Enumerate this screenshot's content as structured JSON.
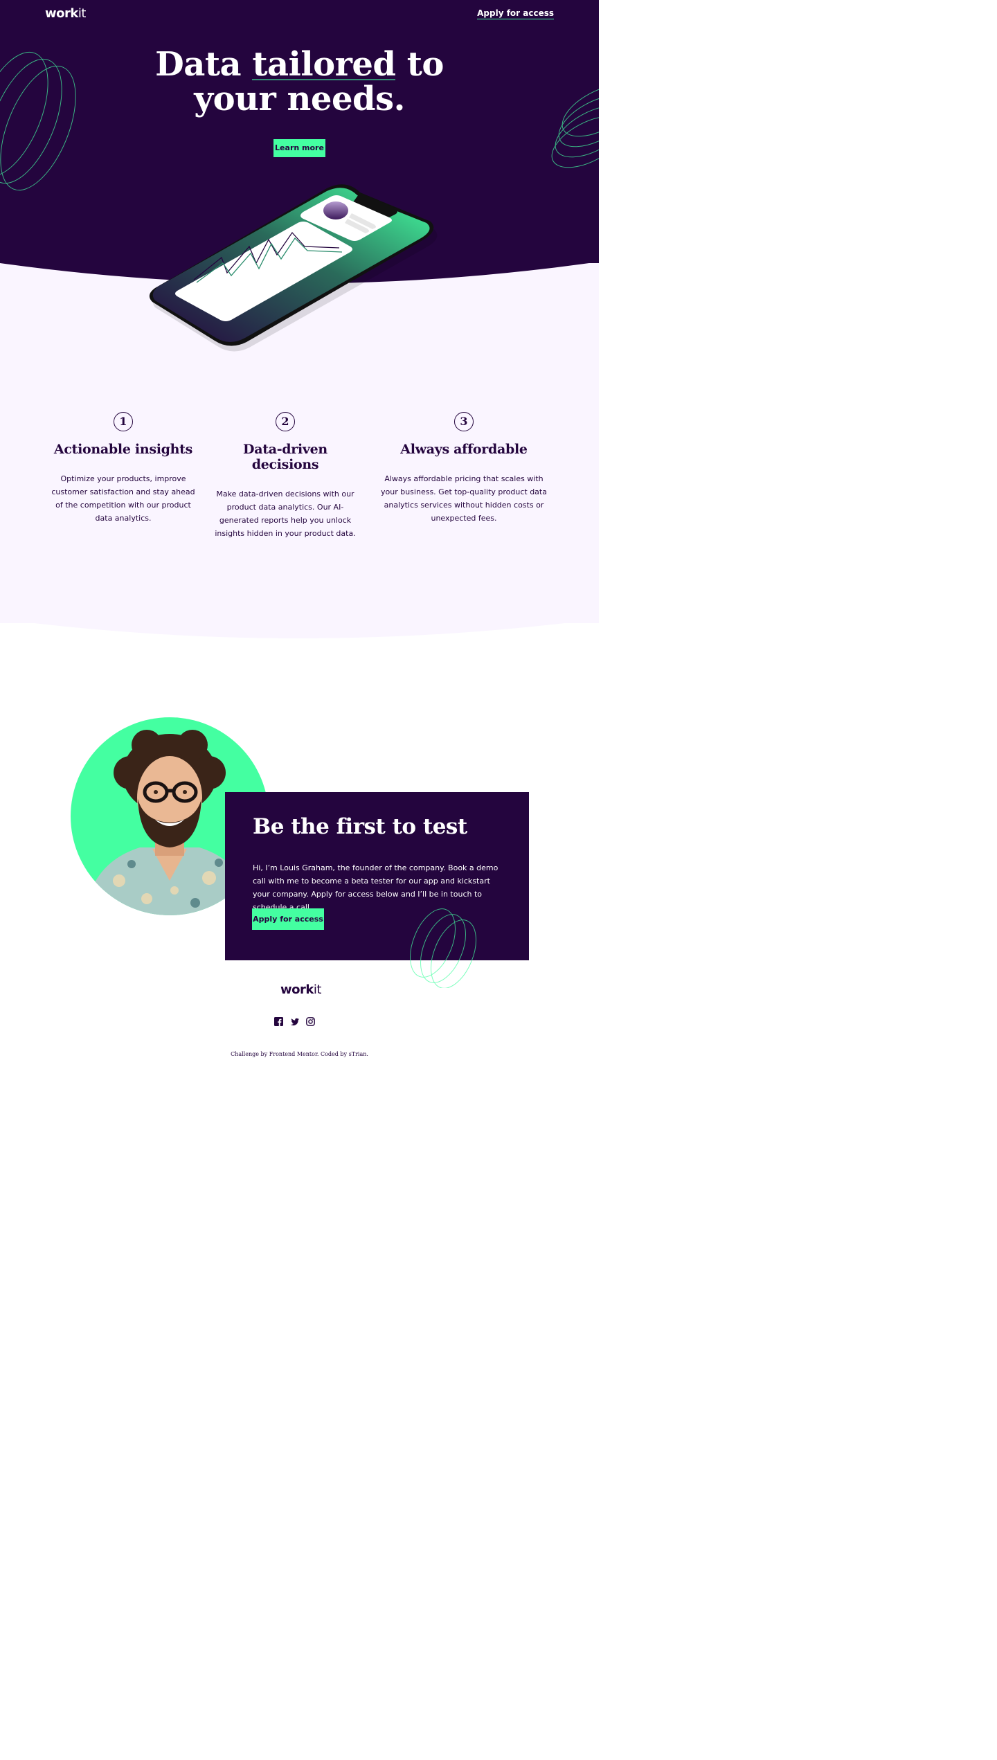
{
  "header": {
    "logo_bold": "work",
    "logo_light": "it",
    "nav_link": "Apply for access"
  },
  "hero": {
    "title_word1": "Data",
    "title_highlight": "tailored",
    "title_word3": "to",
    "title_line2": "your needs.",
    "cta": "Learn more"
  },
  "features": [
    {
      "number": "1",
      "title": "Actionable insights",
      "text": "Optimize your products, improve customer satisfaction and stay ahead of the competition with our product data analytics."
    },
    {
      "number": "2",
      "title": "Data-driven decisions",
      "text": "Make data-driven decisions with our product data analytics. Our AI-generated reports help you unlock insights hidden in your product data."
    },
    {
      "number": "3",
      "title": "Always affordable",
      "text": "Always affordable pricing that scales with your business. Get top-quality product data analytics services without hidden costs or unexpected fees."
    }
  ],
  "beta": {
    "title": "Be the first to test",
    "text": "Hi, I’m Louis Graham, the founder of the company. Book a demo call with me to become a beta tester for our app and kickstart your company. Apply for access below and I’ll be in touch to schedule a call.",
    "cta": "Apply for access"
  },
  "footer": {
    "logo_bold": "work",
    "logo_light": "it",
    "attribution_prefix": "Challenge by",
    "attribution_link1": "Frontend Mentor",
    "attribution_middle": ". Coded by",
    "attribution_link2": "sTrian",
    "attribution_suffix": "."
  },
  "colors": {
    "primary_dark": "#24053e",
    "accent_green": "#44ffa1",
    "light_bg": "#faf5ff",
    "white": "#ffffff"
  },
  "icons": [
    "facebook-icon",
    "twitter-icon",
    "instagram-icon"
  ]
}
